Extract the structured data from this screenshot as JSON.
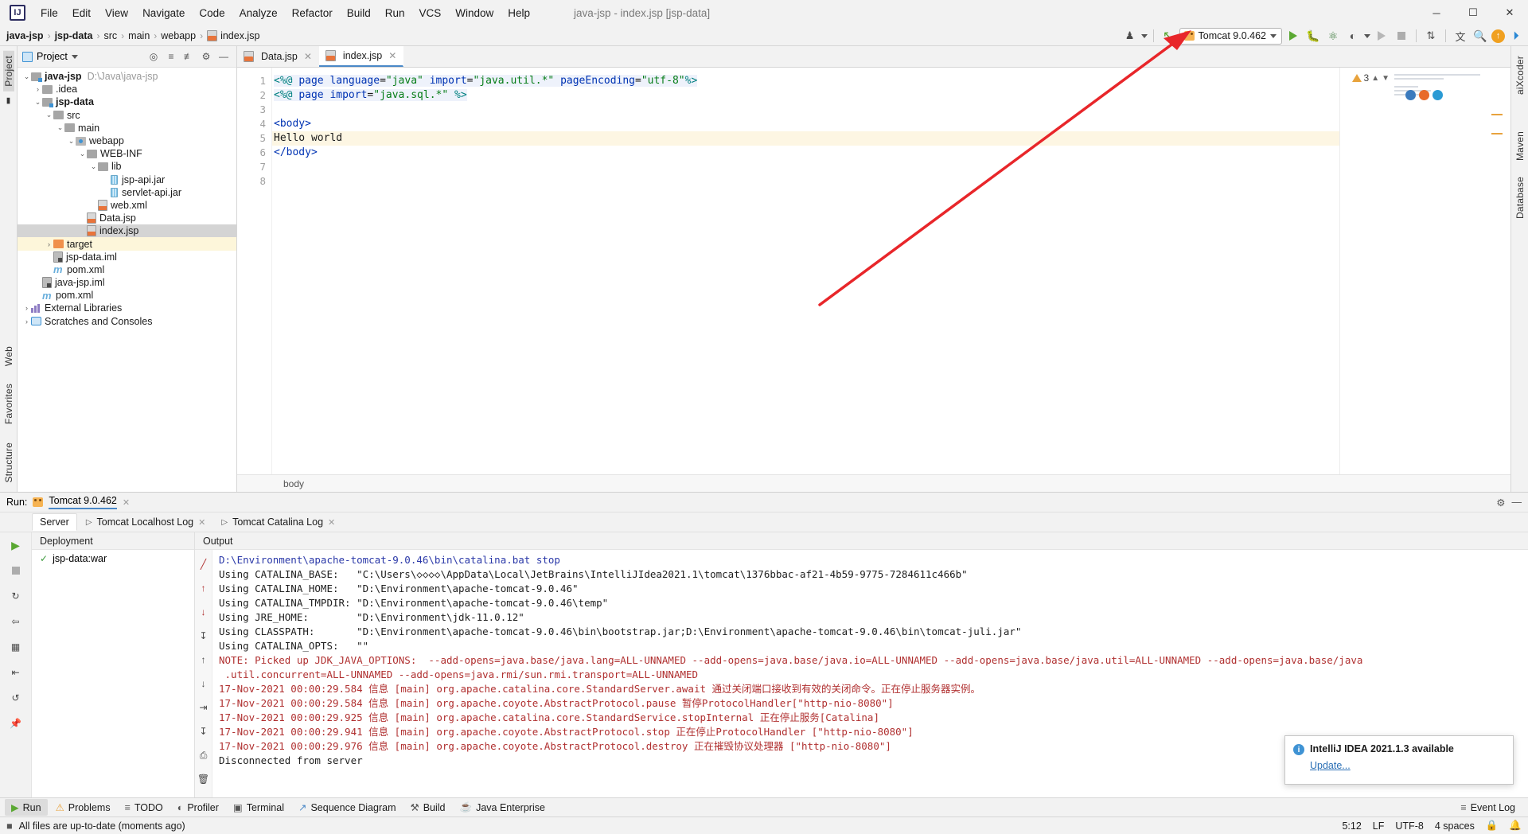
{
  "window": {
    "title": "java-jsp - index.jsp [jsp-data]",
    "minimize": "─",
    "maximize": "☐",
    "close": "✕",
    "logo": "IJ"
  },
  "menu": {
    "items": [
      "File",
      "Edit",
      "View",
      "Navigate",
      "Code",
      "Analyze",
      "Refactor",
      "Build",
      "Run",
      "VCS",
      "Window",
      "Help"
    ]
  },
  "breadcrumbs": {
    "items": [
      "java-jsp",
      "jsp-data",
      "src",
      "main",
      "webapp",
      "index.jsp"
    ]
  },
  "toolbar": {
    "run_config_label": "Tomcat 9.0.462",
    "icons": [
      {
        "name": "user-profile-icon",
        "glyph": "♟"
      },
      {
        "name": "update-project-icon",
        "glyph": "↖"
      },
      {
        "name": "run-icon",
        "glyph": "▶"
      },
      {
        "name": "debug-icon",
        "glyph": "🐞"
      },
      {
        "name": "run-coverage-icon",
        "glyph": "▶"
      },
      {
        "name": "profiler-icon",
        "glyph": "◔"
      },
      {
        "name": "rerun-icon",
        "glyph": "▶"
      },
      {
        "name": "stop-icon",
        "glyph": "■"
      },
      {
        "name": "structure-diff-icon",
        "glyph": "⇅"
      },
      {
        "name": "translate-icon",
        "glyph": "文A"
      },
      {
        "name": "search-everywhere-icon",
        "glyph": "🔍"
      },
      {
        "name": "update-available-icon",
        "glyph": "↑"
      },
      {
        "name": "ai-assistant-icon",
        "glyph": "▶"
      }
    ]
  },
  "left_rail": {
    "project_label": "Project",
    "structure_label": "Structure",
    "favorites_label": "Favorites",
    "web_label": "Web"
  },
  "right_rail": {
    "ai_label": "aiXcoder",
    "maven_label": "Maven",
    "database_label": "Database"
  },
  "project_panel": {
    "title": "Project",
    "tree": [
      {
        "indent": 0,
        "arrow": "⌄",
        "icon": "folder-module",
        "label": "java-jsp",
        "bold": true,
        "path": "D:\\Java\\java-jsp",
        "state": "normal"
      },
      {
        "indent": 1,
        "arrow": "›",
        "icon": "folder",
        "label": ".idea",
        "bold": false,
        "path": "",
        "state": "normal"
      },
      {
        "indent": 1,
        "arrow": "⌄",
        "icon": "folder-module",
        "label": "jsp-data",
        "bold": true,
        "path": "",
        "state": "normal"
      },
      {
        "indent": 2,
        "arrow": "⌄",
        "icon": "folder",
        "label": "src",
        "bold": false,
        "path": "",
        "state": "normal"
      },
      {
        "indent": 3,
        "arrow": "⌄",
        "icon": "folder",
        "label": "main",
        "bold": false,
        "path": "",
        "state": "normal"
      },
      {
        "indent": 4,
        "arrow": "⌄",
        "icon": "folder-web",
        "label": "webapp",
        "bold": false,
        "path": "",
        "state": "normal"
      },
      {
        "indent": 5,
        "arrow": "⌄",
        "icon": "folder",
        "label": "WEB-INF",
        "bold": false,
        "path": "",
        "state": "normal"
      },
      {
        "indent": 6,
        "arrow": "⌄",
        "icon": "folder",
        "label": "lib",
        "bold": false,
        "path": "",
        "state": "normal"
      },
      {
        "indent": 7,
        "arrow": "",
        "icon": "jar",
        "label": "jsp-api.jar",
        "bold": false,
        "path": "",
        "state": "normal"
      },
      {
        "indent": 7,
        "arrow": "",
        "icon": "jar",
        "label": "servlet-api.jar",
        "bold": false,
        "path": "",
        "state": "normal"
      },
      {
        "indent": 6,
        "arrow": "",
        "icon": "file-webxml",
        "label": "web.xml",
        "bold": false,
        "path": "",
        "state": "normal"
      },
      {
        "indent": 5,
        "arrow": "",
        "icon": "file-jsp",
        "label": "Data.jsp",
        "bold": false,
        "path": "",
        "state": "normal"
      },
      {
        "indent": 5,
        "arrow": "",
        "icon": "file-jsp",
        "label": "index.jsp",
        "bold": false,
        "path": "",
        "state": "selected"
      },
      {
        "indent": 2,
        "arrow": "›",
        "icon": "folder-orange",
        "label": "target",
        "bold": false,
        "path": "",
        "state": "highlight"
      },
      {
        "indent": 2,
        "arrow": "",
        "icon": "file-iml",
        "label": "jsp-data.iml",
        "bold": false,
        "path": "",
        "state": "normal"
      },
      {
        "indent": 2,
        "arrow": "",
        "icon": "maven",
        "label": "pom.xml",
        "bold": false,
        "path": "",
        "state": "normal"
      },
      {
        "indent": 1,
        "arrow": "",
        "icon": "file-iml",
        "label": "java-jsp.iml",
        "bold": false,
        "path": "",
        "state": "normal"
      },
      {
        "indent": 1,
        "arrow": "",
        "icon": "maven",
        "label": "pom.xml",
        "bold": false,
        "path": "",
        "state": "normal"
      },
      {
        "indent": 0,
        "arrow": "›",
        "icon": "library",
        "label": "External Libraries",
        "bold": false,
        "path": "",
        "state": "normal"
      },
      {
        "indent": 0,
        "arrow": "›",
        "icon": "scratch",
        "label": "Scratches and Consoles",
        "bold": false,
        "path": "",
        "state": "normal"
      }
    ]
  },
  "editor": {
    "tabs": [
      {
        "label": "Data.jsp",
        "active": false
      },
      {
        "label": "index.jsp",
        "active": true
      }
    ],
    "line_numbers": [
      "1",
      "2",
      "3",
      "4",
      "5",
      "6",
      "7",
      "8"
    ],
    "lines": [
      {
        "n": 1,
        "text": "<%@ page language=\"java\" import=\"java.util.*\" pageEncoding=\"utf-8\"%>"
      },
      {
        "n": 2,
        "text": "<%@ page import=\"java.sql.*\" %>"
      },
      {
        "n": 3,
        "text": ""
      },
      {
        "n": 4,
        "text": "<body>"
      },
      {
        "n": 5,
        "text": "Hello world"
      },
      {
        "n": 6,
        "text": "</body>"
      },
      {
        "n": 7,
        "text": ""
      },
      {
        "n": 8,
        "text": ""
      }
    ],
    "warning_count": "3",
    "breadcrumb": "body"
  },
  "run_panel": {
    "run_label": "Run:",
    "config_name": "Tomcat 9.0.462",
    "tabs": [
      {
        "label": "Server",
        "active": true
      },
      {
        "label": "Tomcat Localhost Log",
        "active": false
      },
      {
        "label": "Tomcat Catalina Log",
        "active": false
      }
    ],
    "deployment_header": "Deployment",
    "deployment_items": [
      "jsp-data:war"
    ],
    "output_header": "Output",
    "console_lines": [
      {
        "color": "blue",
        "text": "D:\\Environment\\apache-tomcat-9.0.46\\bin\\catalina.bat stop"
      },
      {
        "color": "dark",
        "text": "Using CATALINA_BASE:   \"C:\\Users\\◇◇◇◇\\AppData\\Local\\JetBrains\\IntelliJIdea2021.1\\tomcat\\1376bbac-af21-4b59-9775-7284611c466b\""
      },
      {
        "color": "dark",
        "text": "Using CATALINA_HOME:   \"D:\\Environment\\apache-tomcat-9.0.46\""
      },
      {
        "color": "dark",
        "text": "Using CATALINA_TMPDIR: \"D:\\Environment\\apache-tomcat-9.0.46\\temp\""
      },
      {
        "color": "dark",
        "text": "Using JRE_HOME:        \"D:\\Environment\\jdk-11.0.12\""
      },
      {
        "color": "dark",
        "text": "Using CLASSPATH:       \"D:\\Environment\\apache-tomcat-9.0.46\\bin\\bootstrap.jar;D:\\Environment\\apache-tomcat-9.0.46\\bin\\tomcat-juli.jar\""
      },
      {
        "color": "dark",
        "text": "Using CATALINA_OPTS:   \"\""
      },
      {
        "color": "red",
        "text": "NOTE: Picked up JDK_JAVA_OPTIONS:  --add-opens=java.base/java.lang=ALL-UNNAMED --add-opens=java.base/java.io=ALL-UNNAMED --add-opens=java.base/java.util=ALL-UNNAMED --add-opens=java.base/java"
      },
      {
        "color": "red",
        "text": " .util.concurrent=ALL-UNNAMED --add-opens=java.rmi/sun.rmi.transport=ALL-UNNAMED"
      },
      {
        "color": "red",
        "text": "17-Nov-2021 00:00:29.584 信息 [main] org.apache.catalina.core.StandardServer.await 通过关闭端口接收到有效的关闭命令。正在停止服务器实例。"
      },
      {
        "color": "red",
        "text": "17-Nov-2021 00:00:29.584 信息 [main] org.apache.coyote.AbstractProtocol.pause 暂停ProtocolHandler[\"http-nio-8080\"]"
      },
      {
        "color": "red",
        "text": "17-Nov-2021 00:00:29.925 信息 [main] org.apache.catalina.core.StandardService.stopInternal 正在停止服务[Catalina]"
      },
      {
        "color": "red",
        "text": "17-Nov-2021 00:00:29.941 信息 [main] org.apache.coyote.AbstractProtocol.stop 正在停止ProtocolHandler [\"http-nio-8080\"]"
      },
      {
        "color": "red",
        "text": "17-Nov-2021 00:00:29.976 信息 [main] org.apache.coyote.AbstractProtocol.destroy 正在摧毁协议处理器 [\"http-nio-8080\"]"
      },
      {
        "color": "dark",
        "text": "Disconnected from server"
      }
    ]
  },
  "notification": {
    "title": "IntelliJ IDEA 2021.1.3 available",
    "link": "Update...",
    "icon": "i"
  },
  "toolwindow_bar": {
    "left": [
      {
        "label": "Run",
        "icon": "▶",
        "active": true
      },
      {
        "label": "Problems",
        "icon": "⚠",
        "active": false
      },
      {
        "label": "TODO",
        "icon": "≡",
        "active": false
      },
      {
        "label": "Profiler",
        "icon": "◔",
        "active": false
      },
      {
        "label": "Terminal",
        "icon": "▣",
        "active": false
      },
      {
        "label": "Sequence Diagram",
        "icon": "↗",
        "active": false
      },
      {
        "label": "Build",
        "icon": "⚒",
        "active": false
      },
      {
        "label": "Java Enterprise",
        "icon": "☕",
        "active": false
      }
    ],
    "right": [
      {
        "label": "Event Log",
        "icon": "≡"
      }
    ]
  },
  "status_bar": {
    "message": "All files are up-to-date (moments ago)",
    "caret": "5:12",
    "line_sep": "LF",
    "encoding": "UTF-8",
    "indent": "4 spaces",
    "lock_icon": "🔒",
    "notify_icon": "🔔"
  },
  "colors": {
    "accent_blue": "#3f93d4",
    "tab_underline": "#4a88c7",
    "error_red": "#b03030",
    "link_blue": "#2a6fb5",
    "run_green": "#5aa832",
    "annotation_red": "#e8262a"
  }
}
